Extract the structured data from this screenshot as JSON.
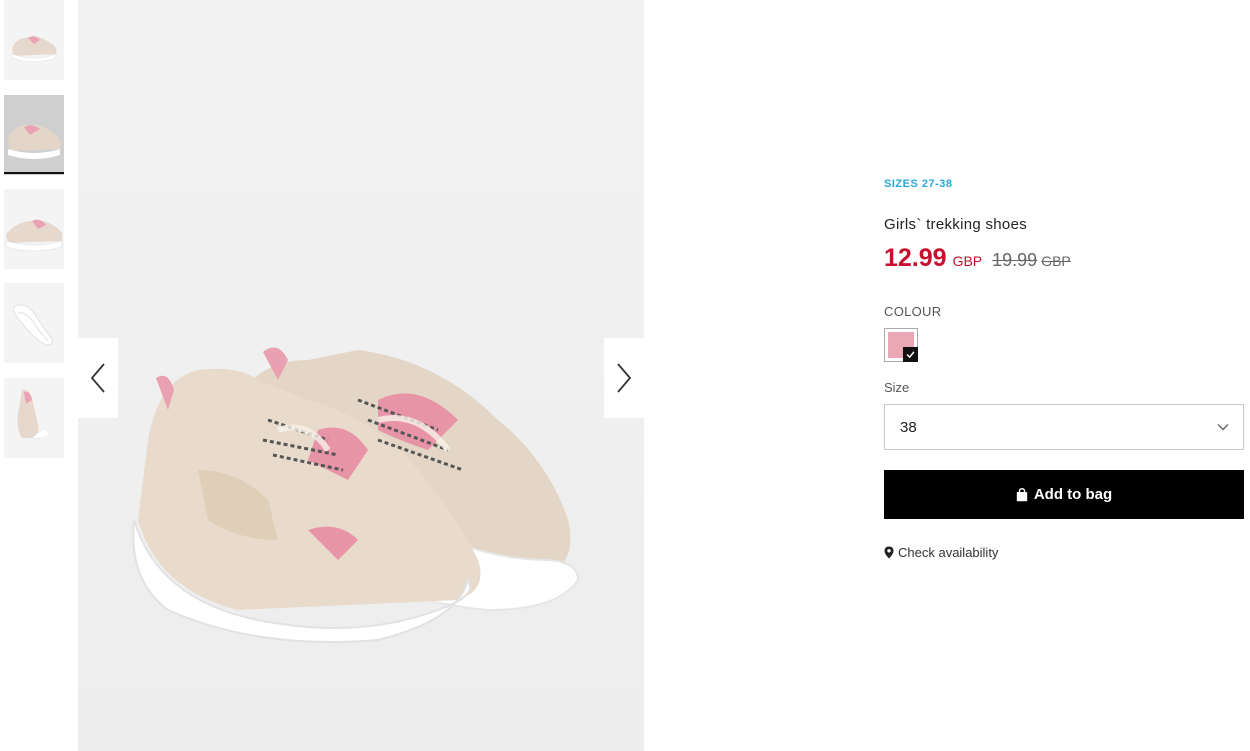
{
  "gallery": {
    "thumbnails": [
      {
        "label": "thumbnail 1",
        "active": false
      },
      {
        "label": "thumbnail 2",
        "active": true
      },
      {
        "label": "thumbnail 3",
        "active": false
      },
      {
        "label": "thumbnail 4",
        "active": false
      },
      {
        "label": "thumbnail 5",
        "active": false
      }
    ],
    "prev_icon": "chevron-left-icon",
    "next_icon": "chevron-right-icon"
  },
  "product": {
    "sizes_range": "SIZES 27-38",
    "title": "Girls` trekking shoes",
    "price_now": "12.99",
    "currency_now": "GBP",
    "price_old": "19.99",
    "currency_old": "GBP",
    "colour_label": "COLOUR",
    "colour_swatch": "#eaa7b4",
    "size_label": "Size",
    "size_selected": "38",
    "add_to_bag_label": "Add to bag",
    "check_availability_label": "Check availability"
  },
  "colors": {
    "accent_sizes": "#2aa6d8",
    "sale_price": "#c8102e",
    "button_bg": "#000000"
  }
}
